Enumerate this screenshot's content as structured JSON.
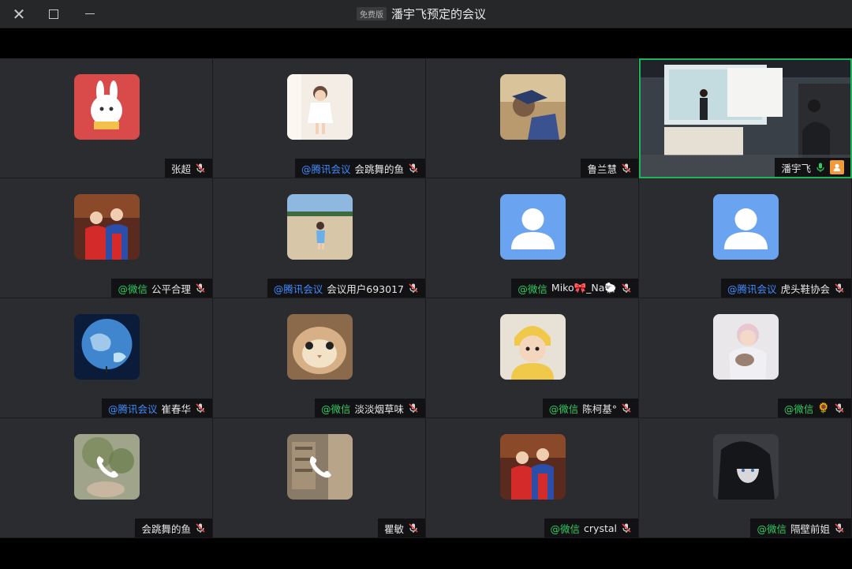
{
  "window": {
    "title": "潘宇飞预定的会议",
    "badge": "免费版"
  },
  "tiles": [
    {
      "name": "张超",
      "platform": "",
      "platform_type": "",
      "avatar": "red-rabbit"
    },
    {
      "name": "会跳舞的鱼",
      "platform": "@腾讯会议",
      "platform_type": "tencent",
      "avatar": "girl-white"
    },
    {
      "name": "鲁兰慧",
      "platform": "",
      "platform_type": "",
      "avatar": "graduate"
    },
    {
      "name": "潘宇飞",
      "platform": "",
      "platform_type": "",
      "avatar": "video-feed"
    },
    {
      "name": "公平合理",
      "platform": "@微信",
      "platform_type": "wechat",
      "avatar": "couple"
    },
    {
      "name": "会议用户693017",
      "platform": "@腾讯会议",
      "platform_type": "tencent",
      "avatar": "beach-kid"
    },
    {
      "name": "Miko🎀_Na🐑",
      "platform": "@微信",
      "platform_type": "wechat",
      "avatar": "default"
    },
    {
      "name": "虎头鞋协会",
      "platform": "@腾讯会议",
      "platform_type": "tencent",
      "avatar": "default"
    },
    {
      "name": "崔春华",
      "platform": "@腾讯会议",
      "platform_type": "tencent",
      "avatar": "earth"
    },
    {
      "name": "淡淡烟草味",
      "platform": "@微信",
      "platform_type": "wechat",
      "avatar": "cat"
    },
    {
      "name": "陈柯基°",
      "platform": "@微信",
      "platform_type": "wechat",
      "avatar": "kid-yellow"
    },
    {
      "name": "🌻",
      "platform": "@微信",
      "platform_type": "wechat",
      "avatar": "baby"
    },
    {
      "name": "会跳舞的鱼",
      "platform": "",
      "platform_type": "",
      "avatar": "phone-plant"
    },
    {
      "name": "瞿敏",
      "platform": "",
      "platform_type": "",
      "avatar": "phone-room"
    },
    {
      "name": "crystal",
      "platform": "@微信",
      "platform_type": "wechat",
      "avatar": "couple"
    },
    {
      "name": "隔壁前姐",
      "platform": "@微信",
      "platform_type": "wechat",
      "avatar": "anime"
    }
  ],
  "colors": {
    "active_border": "#1fb35a",
    "wechat": "#2fcc62",
    "tencent": "#3d8bff"
  }
}
